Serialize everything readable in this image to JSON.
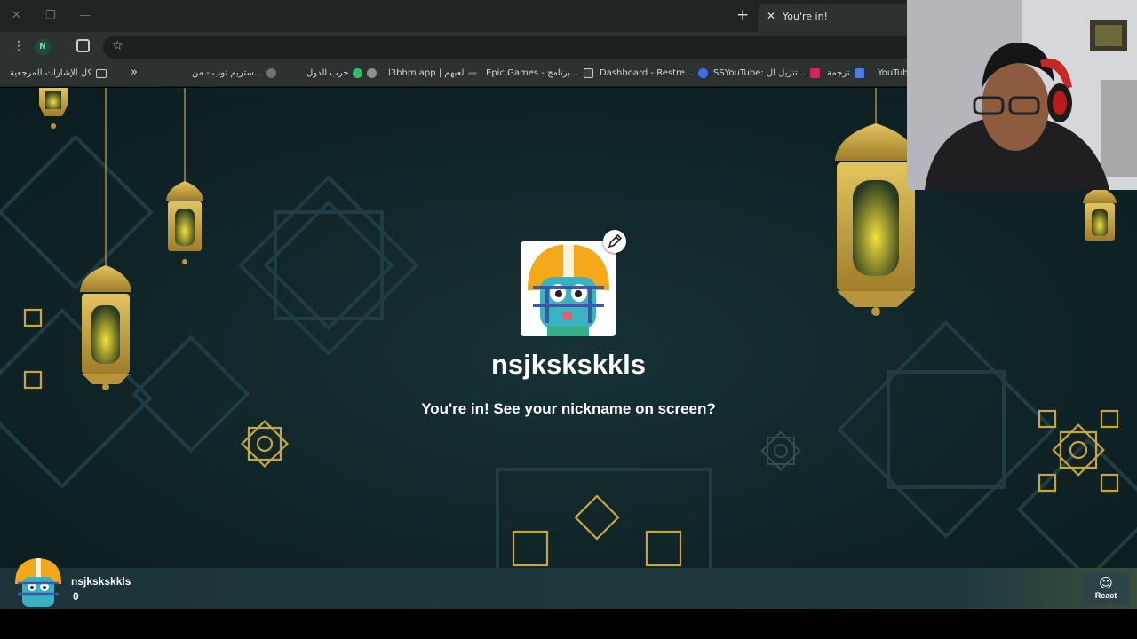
{
  "browser": {
    "tab": {
      "title": "You're in!"
    },
    "profile_initial": "N",
    "bookmarks": [
      {
        "label": "كل الإشارات المرجعية"
      },
      {
        "label": "ستريم توب - من..."
      },
      {
        "label": "حرب الدول"
      },
      {
        "label": "l3bhm.app | لعبهم"
      },
      {
        "label": "Epic Games - برنامج..."
      },
      {
        "label": "Dashboard - Restre..."
      },
      {
        "label": "SSYouTube: تنزيل ال..."
      },
      {
        "label": "ترجمة"
      },
      {
        "label": "YouTube"
      }
    ]
  },
  "game": {
    "nickname": "nsjkskskkls",
    "message": "You're in! See your nickname on screen?",
    "avatar": "football-helmet-monster-avatar"
  },
  "bottom_bar": {
    "player_name": "nsjkskskkls",
    "score": "0",
    "react_label": "React"
  },
  "colors": {
    "background": "#102528",
    "accent_gold": "#c9a53f",
    "pattern": "#1f3d42"
  }
}
